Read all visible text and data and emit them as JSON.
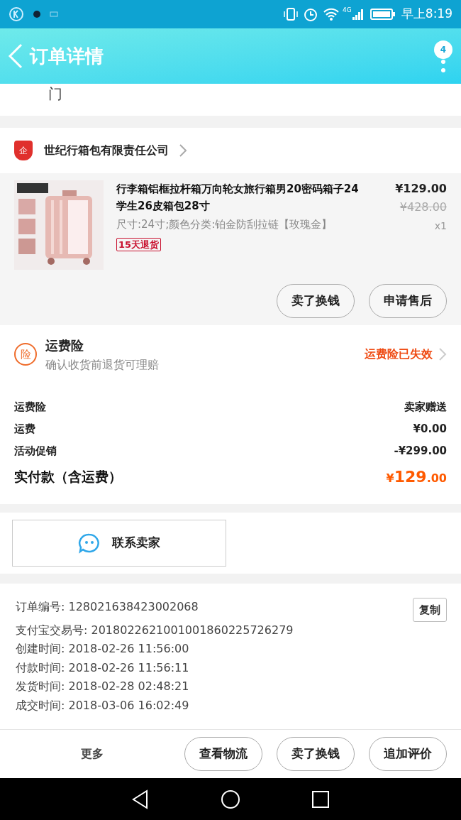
{
  "status_bar": {
    "network": "4G",
    "time": "早上8:19"
  },
  "header": {
    "title": "订单详情",
    "badge": "4"
  },
  "partial_text": "门",
  "shop": {
    "name": "世纪行箱包有限责任公司",
    "logo": "企"
  },
  "product": {
    "title": "行李箱铝框拉杆箱万向轮女旅行箱男20密码箱子24学生26皮箱包28寸",
    "spec": "尺寸:24寸;颜色分类:铂金防刮拉链【玫瑰金】",
    "tag": "15天退货",
    "price": "¥129.00",
    "original_price": "¥428.00",
    "quantity": "x1",
    "actions": [
      "卖了换钱",
      "申请售后"
    ]
  },
  "insurance": {
    "icon": "险",
    "title": "运费险",
    "subtitle": "确认收货前退货可理赔",
    "status": "运费险已失效"
  },
  "fees": [
    {
      "label": "运费险",
      "value": "卖家赠送"
    },
    {
      "label": "运费",
      "value": "¥0.00"
    },
    {
      "label": "活动促销",
      "value": "-¥299.00"
    }
  ],
  "total": {
    "label": "实付款（含运费）",
    "currency": "¥",
    "integer": "129",
    "decimal": ".00"
  },
  "contact": {
    "label": "联系卖家"
  },
  "order_info": {
    "copy": "复制",
    "lines": [
      "订单编号: 128021638423002068",
      "支付宝交易号: 2018022621001001860225726279",
      "创建时间: 2018-02-26 11:56:00",
      "付款时间: 2018-02-26 11:56:11",
      "发货时间: 2018-02-28 02:48:21",
      "成交时间: 2018-03-06 16:02:49"
    ]
  },
  "bottom_bar": {
    "more": "更多",
    "buttons": [
      "查看物流",
      "卖了换钱",
      "追加评价"
    ]
  }
}
